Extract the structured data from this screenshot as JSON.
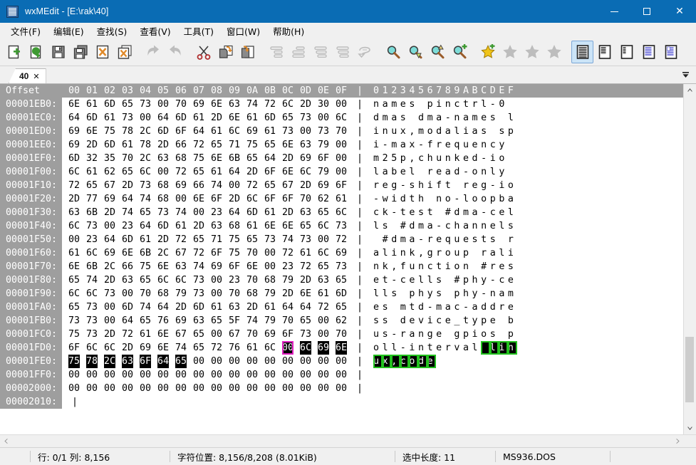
{
  "window": {
    "title": "wxMEdit - [E:\\rak\\40]",
    "icon": "app-icon",
    "controls": {
      "minimize": "—",
      "maximize": "☐",
      "close": "✕"
    },
    "titlebar_color": "#0a6cb4"
  },
  "menubar": {
    "items": [
      {
        "label": "文件(F)",
        "name": "menu-file"
      },
      {
        "label": "编辑(E)",
        "name": "menu-edit"
      },
      {
        "label": "查找(S)",
        "name": "menu-search"
      },
      {
        "label": "查看(V)",
        "name": "menu-view"
      },
      {
        "label": "工具(T)",
        "name": "menu-tools"
      },
      {
        "label": "窗口(W)",
        "name": "menu-window"
      },
      {
        "label": "帮助(H)",
        "name": "menu-help"
      }
    ]
  },
  "toolbar": {
    "buttons": [
      {
        "name": "new-file-button",
        "icon": "new-file-icon",
        "enabled": true,
        "selected": false
      },
      {
        "name": "reload-button",
        "icon": "reload-icon",
        "enabled": true,
        "selected": false
      },
      {
        "name": "save-button",
        "icon": "save-icon",
        "enabled": true,
        "selected": false
      },
      {
        "name": "save-all-button",
        "icon": "save-all-icon",
        "enabled": true,
        "selected": false
      },
      {
        "name": "close-file-button",
        "icon": "close-file-icon",
        "enabled": true,
        "selected": false
      },
      {
        "name": "close-all-button",
        "icon": "close-all-icon",
        "enabled": true,
        "selected": false
      },
      {
        "name": "undo-button",
        "icon": "undo-icon",
        "enabled": false,
        "selected": false
      },
      {
        "name": "redo-button",
        "icon": "redo-icon",
        "enabled": false,
        "selected": false
      },
      {
        "name": "cut-button",
        "icon": "scissors-icon",
        "enabled": true,
        "selected": false
      },
      {
        "name": "copy-button",
        "icon": "copy-icon",
        "enabled": true,
        "selected": false
      },
      {
        "name": "paste-button",
        "icon": "paste-icon",
        "enabled": true,
        "selected": false
      },
      {
        "name": "indent-button",
        "icon": "indent-icon",
        "enabled": false,
        "selected": false
      },
      {
        "name": "unindent-button",
        "icon": "unindent-icon",
        "enabled": false,
        "selected": false
      },
      {
        "name": "comment-button",
        "icon": "comment-lines-icon",
        "enabled": false,
        "selected": false
      },
      {
        "name": "uncomment-button",
        "icon": "uncomment-icon",
        "enabled": false,
        "selected": false
      },
      {
        "name": "wrap-button",
        "icon": "wrap-icon",
        "enabled": false,
        "selected": false
      },
      {
        "name": "find-button",
        "icon": "search-icon",
        "enabled": true,
        "selected": false
      },
      {
        "name": "find-next-button",
        "icon": "search-down-icon",
        "enabled": true,
        "selected": false
      },
      {
        "name": "find-prev-button",
        "icon": "search-up-icon",
        "enabled": true,
        "selected": false
      },
      {
        "name": "replace-button",
        "icon": "search-add-icon",
        "enabled": true,
        "selected": false
      },
      {
        "name": "add-bookmark-button",
        "icon": "star-add-icon",
        "enabled": true,
        "selected": false
      },
      {
        "name": "next-bookmark-button",
        "icon": "star-next-icon",
        "enabled": false,
        "selected": false
      },
      {
        "name": "prev-bookmark-button",
        "icon": "star-prev-icon",
        "enabled": false,
        "selected": false
      },
      {
        "name": "clear-bookmarks-button",
        "icon": "star-clear-icon",
        "enabled": false,
        "selected": false
      },
      {
        "name": "hex-mode-button",
        "icon": "hex-mode-icon",
        "enabled": true,
        "selected": true
      },
      {
        "name": "column-mode-button",
        "icon": "column-mode-icon",
        "enabled": true,
        "selected": false
      },
      {
        "name": "text-mode-button",
        "icon": "text-mode-icon",
        "enabled": true,
        "selected": false
      },
      {
        "name": "preview-button",
        "icon": "preview-icon",
        "enabled": true,
        "selected": false
      },
      {
        "name": "preview-alt-button",
        "icon": "preview-alt-icon",
        "enabled": true,
        "selected": false
      }
    ]
  },
  "tabs": {
    "items": [
      {
        "label": "40",
        "close": "✕",
        "active": true
      }
    ],
    "dropdown_icon": "chevron-down-icon"
  },
  "hex_view": {
    "header": {
      "offset_label": "Offset",
      "byte_columns": [
        "00",
        "01",
        "02",
        "03",
        "04",
        "05",
        "06",
        "07",
        "08",
        "09",
        "0A",
        "0B",
        "0C",
        "0D",
        "0E",
        "0F"
      ],
      "separator": "|",
      "ascii_label": "0123456789ABCDEF"
    },
    "rows": [
      {
        "offset": "00001EB0:",
        "bytes": [
          "6E",
          "61",
          "6D",
          "65",
          "73",
          "00",
          "70",
          "69",
          "6E",
          "63",
          "74",
          "72",
          "6C",
          "2D",
          "30",
          "00"
        ],
        "ascii": "names pinctrl-0 "
      },
      {
        "offset": "00001EC0:",
        "bytes": [
          "64",
          "6D",
          "61",
          "73",
          "00",
          "64",
          "6D",
          "61",
          "2D",
          "6E",
          "61",
          "6D",
          "65",
          "73",
          "00",
          "6C"
        ],
        "ascii": "dmas dma-names l"
      },
      {
        "offset": "00001ED0:",
        "bytes": [
          "69",
          "6E",
          "75",
          "78",
          "2C",
          "6D",
          "6F",
          "64",
          "61",
          "6C",
          "69",
          "61",
          "73",
          "00",
          "73",
          "70"
        ],
        "ascii": "inux,modalias sp"
      },
      {
        "offset": "00001EE0:",
        "bytes": [
          "69",
          "2D",
          "6D",
          "61",
          "78",
          "2D",
          "66",
          "72",
          "65",
          "71",
          "75",
          "65",
          "6E",
          "63",
          "79",
          "00"
        ],
        "ascii": "i-max-frequency "
      },
      {
        "offset": "00001EF0:",
        "bytes": [
          "6D",
          "32",
          "35",
          "70",
          "2C",
          "63",
          "68",
          "75",
          "6E",
          "6B",
          "65",
          "64",
          "2D",
          "69",
          "6F",
          "00"
        ],
        "ascii": "m25p,chunked-io "
      },
      {
        "offset": "00001F00:",
        "bytes": [
          "6C",
          "61",
          "62",
          "65",
          "6C",
          "00",
          "72",
          "65",
          "61",
          "64",
          "2D",
          "6F",
          "6E",
          "6C",
          "79",
          "00"
        ],
        "ascii": "label read-only "
      },
      {
        "offset": "00001F10:",
        "bytes": [
          "72",
          "65",
          "67",
          "2D",
          "73",
          "68",
          "69",
          "66",
          "74",
          "00",
          "72",
          "65",
          "67",
          "2D",
          "69",
          "6F"
        ],
        "ascii": "reg-shift reg-io"
      },
      {
        "offset": "00001F20:",
        "bytes": [
          "2D",
          "77",
          "69",
          "64",
          "74",
          "68",
          "00",
          "6E",
          "6F",
          "2D",
          "6C",
          "6F",
          "6F",
          "70",
          "62",
          "61"
        ],
        "ascii": "-width no-loopba"
      },
      {
        "offset": "00001F30:",
        "bytes": [
          "63",
          "6B",
          "2D",
          "74",
          "65",
          "73",
          "74",
          "00",
          "23",
          "64",
          "6D",
          "61",
          "2D",
          "63",
          "65",
          "6C"
        ],
        "ascii": "ck-test #dma-cel"
      },
      {
        "offset": "00001F40:",
        "bytes": [
          "6C",
          "73",
          "00",
          "23",
          "64",
          "6D",
          "61",
          "2D",
          "63",
          "68",
          "61",
          "6E",
          "6E",
          "65",
          "6C",
          "73"
        ],
        "ascii": "ls #dma-channels"
      },
      {
        "offset": "00001F50:",
        "bytes": [
          "00",
          "23",
          "64",
          "6D",
          "61",
          "2D",
          "72",
          "65",
          "71",
          "75",
          "65",
          "73",
          "74",
          "73",
          "00",
          "72"
        ],
        "ascii": " #dma-requests r"
      },
      {
        "offset": "00001F60:",
        "bytes": [
          "61",
          "6C",
          "69",
          "6E",
          "6B",
          "2C",
          "67",
          "72",
          "6F",
          "75",
          "70",
          "00",
          "72",
          "61",
          "6C",
          "69"
        ],
        "ascii": "alink,group rali"
      },
      {
        "offset": "00001F70:",
        "bytes": [
          "6E",
          "6B",
          "2C",
          "66",
          "75",
          "6E",
          "63",
          "74",
          "69",
          "6F",
          "6E",
          "00",
          "23",
          "72",
          "65",
          "73"
        ],
        "ascii": "nk,function #res"
      },
      {
        "offset": "00001F80:",
        "bytes": [
          "65",
          "74",
          "2D",
          "63",
          "65",
          "6C",
          "6C",
          "73",
          "00",
          "23",
          "70",
          "68",
          "79",
          "2D",
          "63",
          "65"
        ],
        "ascii": "et-cells #phy-ce"
      },
      {
        "offset": "00001F90:",
        "bytes": [
          "6C",
          "6C",
          "73",
          "00",
          "70",
          "68",
          "79",
          "73",
          "00",
          "70",
          "68",
          "79",
          "2D",
          "6E",
          "61",
          "6D"
        ],
        "ascii": "lls phys phy-nam"
      },
      {
        "offset": "00001FA0:",
        "bytes": [
          "65",
          "73",
          "00",
          "6D",
          "74",
          "64",
          "2D",
          "6D",
          "61",
          "63",
          "2D",
          "61",
          "64",
          "64",
          "72",
          "65"
        ],
        "ascii": "es mtd-mac-addre"
      },
      {
        "offset": "00001FB0:",
        "bytes": [
          "73",
          "73",
          "00",
          "64",
          "65",
          "76",
          "69",
          "63",
          "65",
          "5F",
          "74",
          "79",
          "70",
          "65",
          "00",
          "62"
        ],
        "ascii": "ss device_type b"
      },
      {
        "offset": "00001FC0:",
        "bytes": [
          "75",
          "73",
          "2D",
          "72",
          "61",
          "6E",
          "67",
          "65",
          "00",
          "67",
          "70",
          "69",
          "6F",
          "73",
          "00",
          "70"
        ],
        "ascii": "us-range gpios p"
      },
      {
        "offset": "00001FD0:",
        "bytes": [
          "6F",
          "6C",
          "6C",
          "2D",
          "69",
          "6E",
          "74",
          "65",
          "72",
          "76",
          "61",
          "6C",
          "00",
          "6C",
          "69",
          "6E"
        ],
        "ascii": "oll-interval lin",
        "cursor_index": 12,
        "selection_from": 12,
        "selection_to": 15,
        "ascii_caret_index": 12,
        "ascii_sel_from": 13,
        "ascii_sel_to": 15
      },
      {
        "offset": "00001FE0:",
        "bytes": [
          "75",
          "78",
          "2C",
          "63",
          "6F",
          "64",
          "65",
          "00",
          "00",
          "00",
          "00",
          "00",
          "00",
          "00",
          "00",
          "00"
        ],
        "ascii": "ux,code",
        "selection_from": 0,
        "selection_to": 6,
        "ascii_sel_from": 0,
        "ascii_sel_to": 6
      },
      {
        "offset": "00001FF0:",
        "bytes": [
          "00",
          "00",
          "00",
          "00",
          "00",
          "00",
          "00",
          "00",
          "00",
          "00",
          "00",
          "00",
          "00",
          "00",
          "00",
          "00"
        ],
        "ascii": ""
      },
      {
        "offset": "00002000:",
        "bytes": [
          "00",
          "00",
          "00",
          "00",
          "00",
          "00",
          "00",
          "00",
          "00",
          "00",
          "00",
          "00",
          "00",
          "00",
          "00",
          "00"
        ],
        "ascii": ""
      },
      {
        "offset": "00002010:",
        "bytes": [],
        "ascii": ""
      }
    ],
    "colors": {
      "gutter_bg": "#9e9e9e",
      "gutter_fg": "#ffffff",
      "body_bg": "#ffffff",
      "body_fg": "#000000",
      "selection_bg": "#000000",
      "selection_fg": "#ffffff",
      "hex_cursor_outline": "#e020c0",
      "ascii_cursor_outline": "#22c11e"
    }
  },
  "scrollbars": {
    "vertical": {
      "up_icon": "chevron-up-icon",
      "down_icon": "chevron-down-icon"
    },
    "horizontal": {
      "left_icon": "chevron-left-icon",
      "right_icon": "chevron-right-icon"
    }
  },
  "statusbar": {
    "cells": [
      {
        "name": "status-line-column",
        "text": "行: 0/1  列: 8,156"
      },
      {
        "name": "status-char-position",
        "text": "字符位置: 8,156/8,208  (8.01KiB)"
      },
      {
        "name": "status-selection-length",
        "text": "选中长度: 11"
      },
      {
        "name": "status-encoding",
        "text": "MS936.DOS"
      }
    ]
  }
}
